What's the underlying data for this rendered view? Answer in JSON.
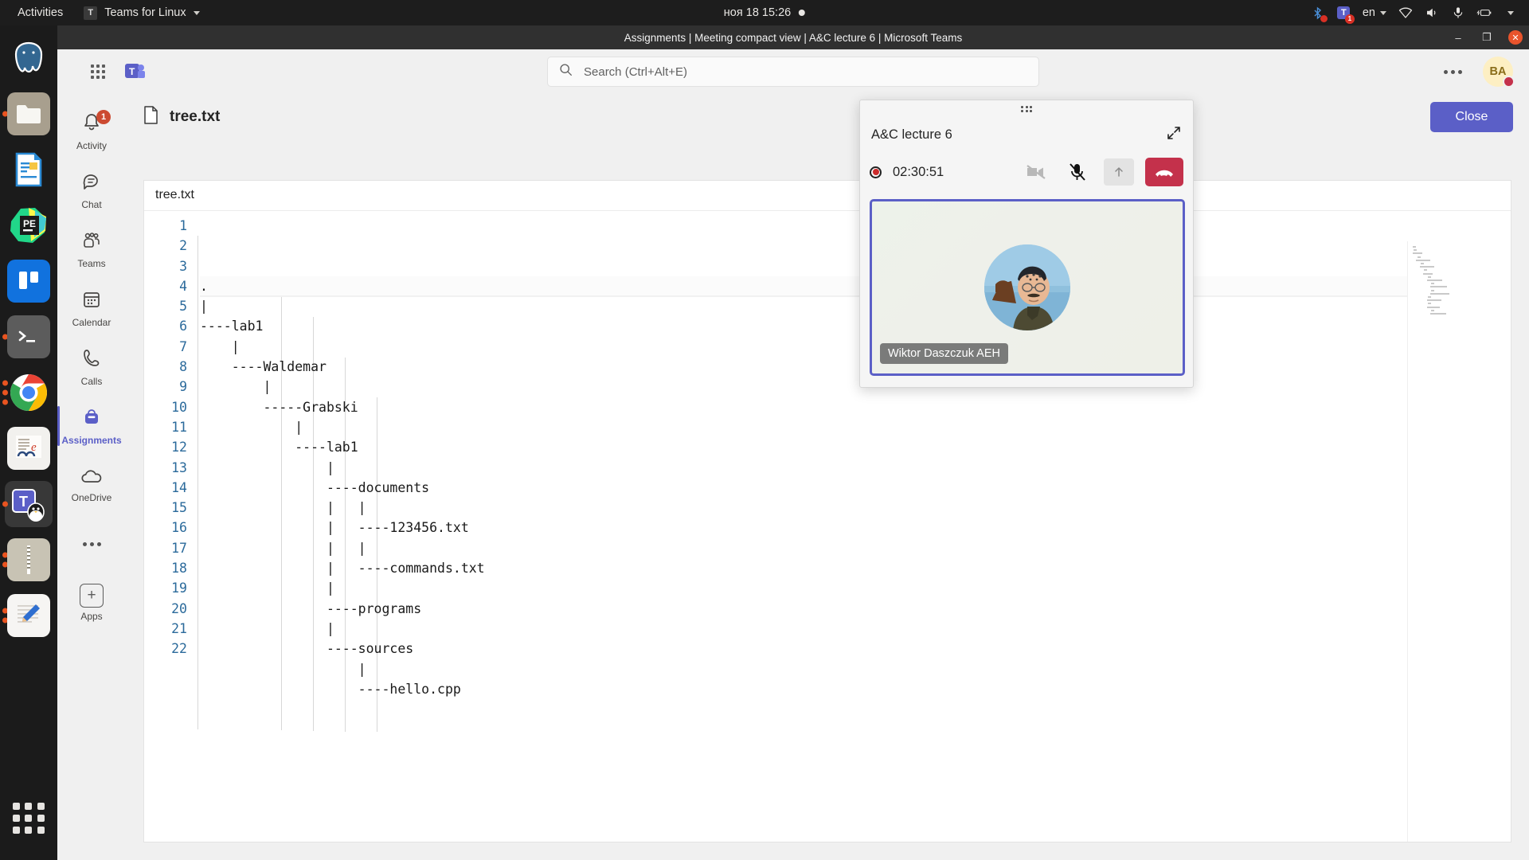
{
  "gnome": {
    "activities": "Activities",
    "app_menu": "Teams for Linux",
    "app_icon": "teams-for-linux-icon",
    "clock": "ноя 18  15:26",
    "tray": {
      "bluetooth": "bluetooth-icon",
      "teams_badge": "1",
      "language": "en",
      "wifi": "wifi-icon",
      "volume": "volume-icon",
      "mic": "microphone-icon",
      "battery": "battery-charging-icon",
      "menu": "chevron-down-icon"
    }
  },
  "dock": {
    "items": [
      {
        "name": "postgresql",
        "label": "PostgreSQL",
        "running_dots": 0
      },
      {
        "name": "files",
        "label": "Files",
        "running_dots": 1
      },
      {
        "name": "libreoffice-writer",
        "label": "LibreOffice Writer",
        "running_dots": 0
      },
      {
        "name": "pycharm",
        "label": "PyCharm",
        "running_dots": 0
      },
      {
        "name": "trello",
        "label": "Trello",
        "running_dots": 0
      },
      {
        "name": "terminal",
        "label": "Terminal",
        "running_dots": 1
      },
      {
        "name": "google-chrome",
        "label": "Google Chrome",
        "running_dots": 3
      },
      {
        "name": "document-viewer",
        "label": "Document Viewer",
        "running_dots": 0
      },
      {
        "name": "teams-for-linux",
        "label": "Teams for Linux",
        "running_dots": 1,
        "active": true
      },
      {
        "name": "archive-manager",
        "label": "Archive Manager",
        "running_dots": 2
      },
      {
        "name": "text-editor",
        "label": "Text Editor",
        "running_dots": 2
      }
    ],
    "show_apps": "Show Applications"
  },
  "window": {
    "title": "Assignments | Meeting compact view | A&C lecture 6 | Microsoft Teams",
    "controls": {
      "minimize": "minimize-icon",
      "maximize": "maximize-icon",
      "close": "close-icon"
    }
  },
  "teams": {
    "header": {
      "waffle": "app-waffle-icon",
      "logo": "teams-logo-icon",
      "search_placeholder": "Search (Ctrl+Alt+E)",
      "search_value": "",
      "more": "more-options-icon",
      "avatar_initials": "BA",
      "avatar_status": "busy"
    },
    "rail": [
      {
        "label": "Activity",
        "icon": "bell-icon",
        "badge": "1",
        "selected": false
      },
      {
        "label": "Chat",
        "icon": "chat-icon",
        "badge": "",
        "selected": false
      },
      {
        "label": "Teams",
        "icon": "teams-people-icon",
        "badge": "",
        "selected": false
      },
      {
        "label": "Calendar",
        "icon": "calendar-icon",
        "badge": "",
        "selected": false
      },
      {
        "label": "Calls",
        "icon": "phone-icon",
        "badge": "",
        "selected": false
      },
      {
        "label": "Assignments",
        "icon": "backpack-icon",
        "badge": "",
        "selected": true
      },
      {
        "label": "OneDrive",
        "icon": "cloud-icon",
        "badge": "",
        "selected": false
      },
      {
        "label": "",
        "icon": "more-apps-icon",
        "badge": "",
        "selected": false
      },
      {
        "label": "Apps",
        "icon": "plus-icon",
        "badge": "",
        "selected": false
      }
    ],
    "assignments": {
      "file_icon": "file-icon",
      "file_name": "tree.txt",
      "close_label": "Close"
    },
    "colors": {
      "accent": "#5b5fc7",
      "badge": "#cc4a31",
      "busy": "#c4314b"
    }
  },
  "editor": {
    "tab_label": "tree.txt",
    "lines": [
      ".",
      "|",
      "----lab1",
      "    |",
      "    ----Waldemar",
      "        |",
      "        -----Grabski",
      "            |",
      "            ----lab1",
      "                |",
      "                ----documents",
      "                |   |",
      "                |   ----123456.txt",
      "                |   |",
      "                |   ----commands.txt",
      "                |",
      "                ----programs",
      "                |",
      "                ----sources",
      "                    |",
      "                    ----hello.cpp",
      ""
    ],
    "line_numbers": [
      "1",
      "2",
      "3",
      "4",
      "5",
      "6",
      "7",
      "8",
      "9",
      "10",
      "11",
      "12",
      "13",
      "14",
      "15",
      "16",
      "17",
      "18",
      "19",
      "20",
      "21",
      "22"
    ]
  },
  "meeting": {
    "drag_handle": "drag-handle-icon",
    "title": "A&C lecture 6",
    "expand_icon": "expand-icon",
    "recording_icon": "recording-indicator-icon",
    "timer": "02:30:51",
    "controls": [
      {
        "name": "camera-off-button",
        "icon": "camera-off-icon"
      },
      {
        "name": "mic-muted-button",
        "icon": "microphone-muted-icon"
      },
      {
        "name": "share-screen-button",
        "icon": "share-up-arrow-icon"
      },
      {
        "name": "hang-up-button",
        "icon": "hang-up-icon"
      }
    ],
    "participant_name": "Wiktor Daszczuk AEH"
  }
}
